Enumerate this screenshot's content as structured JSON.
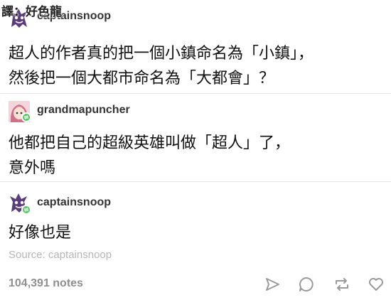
{
  "watermark": {
    "text": "譯：好色龍"
  },
  "posts": [
    {
      "username": "captainsnoop",
      "avatar_icon": "ghost-avatar-icon",
      "text": "超人的作者真的把一個小鎮命名為「小鎮」，\n然後把一個大都市命名為「大都會」？"
    },
    {
      "username": "grandmapuncher",
      "avatar_icon": "anime-girl-avatar-icon",
      "text": "他都把自己的超級英雄叫做「超人」了，\n意外嗎"
    },
    {
      "username": "captainsnoop",
      "avatar_icon": "ghost-avatar-icon",
      "text": "好像也是"
    }
  ],
  "footer": {
    "source": "Source: captainsnoop",
    "notes": "104,391 notes",
    "actions": [
      {
        "name": "share-icon"
      },
      {
        "name": "comment-icon"
      },
      {
        "name": "reblog-icon"
      },
      {
        "name": "like-heart-icon"
      }
    ]
  },
  "colors": {
    "reblog_badge": "#5cc46b",
    "username": "#333333",
    "meta_text": "#b5b5b5",
    "icon": "#9a9a9a"
  }
}
